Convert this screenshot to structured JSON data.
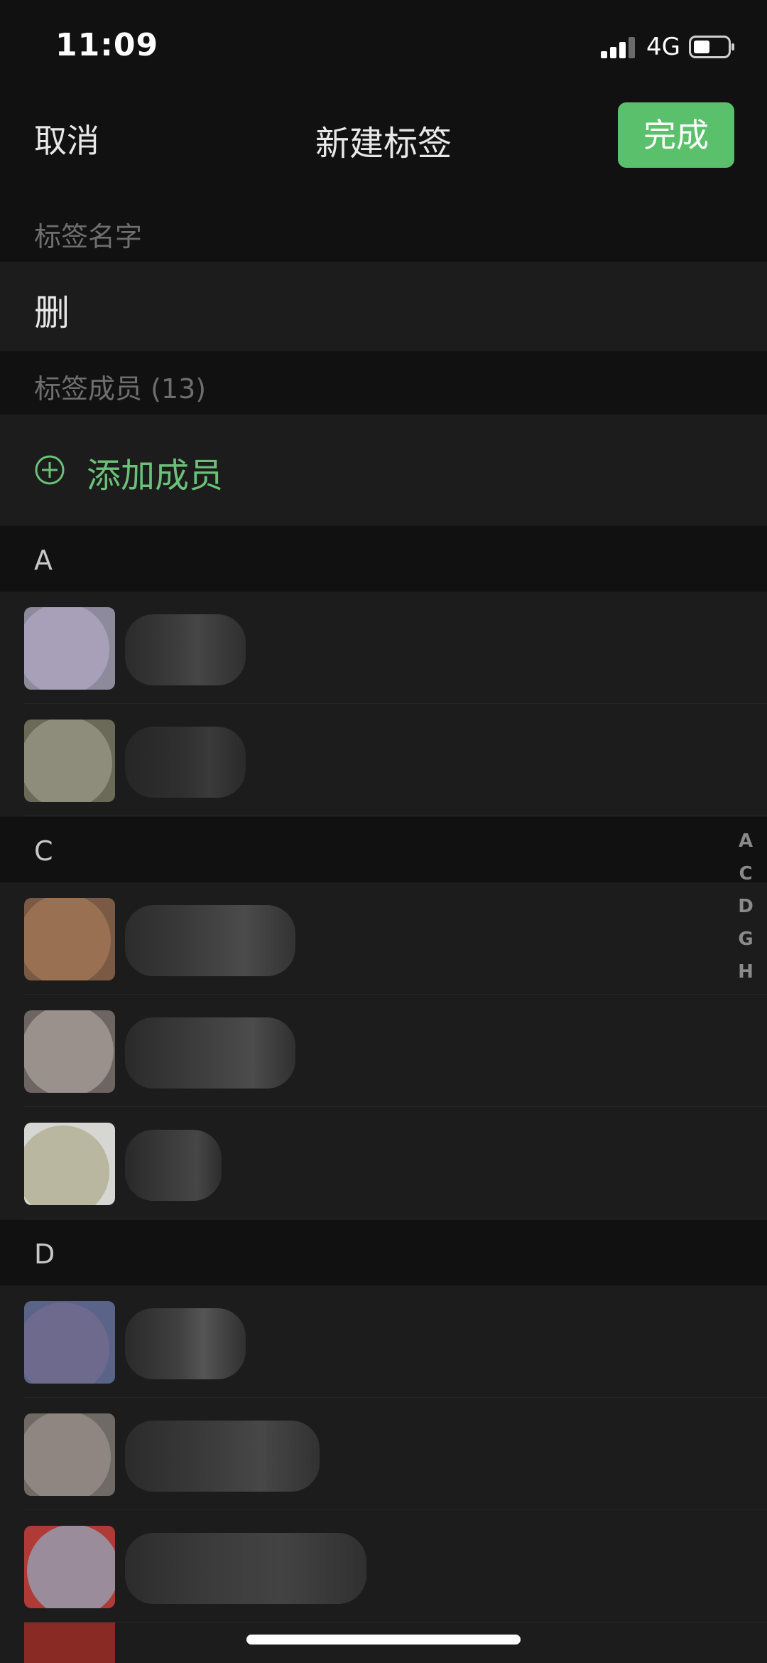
{
  "status_bar": {
    "time": "11:09",
    "network": "4G",
    "signal_icon": "signal-bars-icon",
    "battery_icon": "battery-icon"
  },
  "nav": {
    "cancel_label": "取消",
    "title": "新建标签",
    "done_label": "完成",
    "done_color": "#5bc06b"
  },
  "tag_name": {
    "section_label": "标签名字",
    "value": "删"
  },
  "members": {
    "section_label": "标签成员 (13)",
    "add_label": "添加成员",
    "add_icon": "plus-circle-icon",
    "accent_color": "#6bc178"
  },
  "groups": [
    {
      "letter": "A"
    },
    {
      "letter": "C"
    },
    {
      "letter": "D"
    }
  ],
  "index_letters": [
    "A",
    "C",
    "D",
    "G",
    "H"
  ]
}
